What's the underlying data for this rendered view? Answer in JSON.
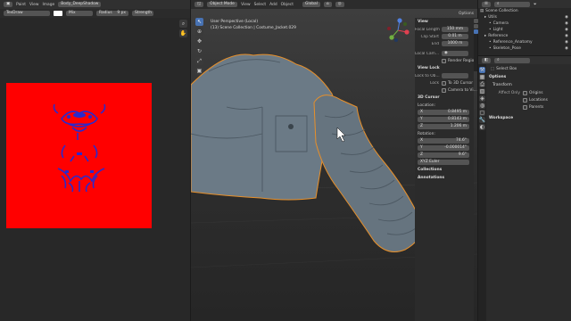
{
  "image_editor": {
    "menu": [
      "Paint",
      "View",
      "Image"
    ],
    "image_name": "Body_DeepShadow",
    "tool_name": "TexDraw",
    "blend": "Mix",
    "radius_label": "Radius",
    "radius_value": "9 px",
    "strength_label": "Strength",
    "canvas_color": "#ff0000",
    "stroke_color": "#2a2acc"
  },
  "viewport": {
    "mode": "Object Mode",
    "menu": [
      "View",
      "Select",
      "Add",
      "Object"
    ],
    "orientation": "Global",
    "options_label": "Options",
    "perspective_text": "User Perspective (Local)",
    "collection_text": "(13) Scene Collection | Costume_Jacket.029"
  },
  "n_panel": {
    "view_header": "View",
    "focal_length": {
      "label": "Focal Length",
      "value": "150 mm"
    },
    "clip_start": {
      "label": "Clip Start",
      "value": "0.01 m"
    },
    "clip_end": {
      "label": "End",
      "value": "1000 m"
    },
    "local_camera_label": "Local Cam...",
    "render_region_label": "Render Region",
    "view_lock_header": "View Lock",
    "lock_to_object_label": "Lock to Ob...",
    "lock_label": "Lock",
    "to_3d_cursor_label": "To 3D Cursor",
    "camera_to_view_label": "Camera to Vi...",
    "cursor_header": "3D Cursor",
    "location_label": "Location:",
    "loc_x": {
      "axis": "X",
      "value": "0.8495 m"
    },
    "loc_y": {
      "axis": "Y",
      "value": "0.8143 m"
    },
    "loc_z": {
      "axis": "Z",
      "value": "1.206 m"
    },
    "rotation_label": "Rotation:",
    "rot_x": {
      "axis": "X",
      "value": "74.6°"
    },
    "rot_y": {
      "axis": "Y",
      "value": "-0.000014°"
    },
    "rot_z": {
      "axis": "Z",
      "value": "9.6°"
    },
    "rotation_mode": "XYZ Euler",
    "collections_header": "Collections",
    "annotations_header": "Annotations",
    "tabs": [
      "Item",
      "Tool",
      "View"
    ]
  },
  "outliner": {
    "root": "Scene Collection",
    "items": [
      {
        "label": "Utils",
        "indent": 1
      },
      {
        "label": "Camera",
        "indent": 2
      },
      {
        "label": "Light",
        "indent": 2
      },
      {
        "label": "Reference",
        "indent": 1
      },
      {
        "label": "Reference_Anatomy",
        "indent": 2
      },
      {
        "label": "Skeleton_Pose",
        "indent": 2
      }
    ]
  },
  "properties": {
    "tool_label": "Select Box",
    "options_header": "Options",
    "transform_header": "Transform",
    "affect_only_label": "Affect Only",
    "origins_label": "Origins",
    "locations_label": "Locations",
    "parents_label": "Parents",
    "workspace_header": "Workspace"
  },
  "colors": {
    "accent": "#4772b3",
    "selection_outline": "#e8902a",
    "mesh": "#6b7a86"
  }
}
